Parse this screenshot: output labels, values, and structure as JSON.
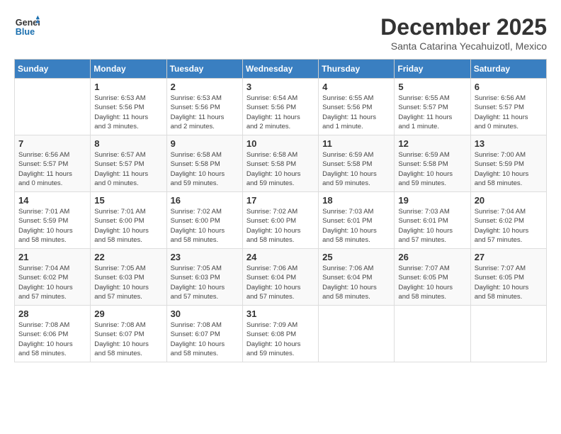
{
  "logo": {
    "line1": "General",
    "line2": "Blue"
  },
  "title": "December 2025",
  "subtitle": "Santa Catarina Yecahuizotl, Mexico",
  "weekdays": [
    "Sunday",
    "Monday",
    "Tuesday",
    "Wednesday",
    "Thursday",
    "Friday",
    "Saturday"
  ],
  "weeks": [
    [
      {
        "day": "",
        "info": ""
      },
      {
        "day": "1",
        "info": "Sunrise: 6:53 AM\nSunset: 5:56 PM\nDaylight: 11 hours\nand 3 minutes."
      },
      {
        "day": "2",
        "info": "Sunrise: 6:53 AM\nSunset: 5:56 PM\nDaylight: 11 hours\nand 2 minutes."
      },
      {
        "day": "3",
        "info": "Sunrise: 6:54 AM\nSunset: 5:56 PM\nDaylight: 11 hours\nand 2 minutes."
      },
      {
        "day": "4",
        "info": "Sunrise: 6:55 AM\nSunset: 5:56 PM\nDaylight: 11 hours\nand 1 minute."
      },
      {
        "day": "5",
        "info": "Sunrise: 6:55 AM\nSunset: 5:57 PM\nDaylight: 11 hours\nand 1 minute."
      },
      {
        "day": "6",
        "info": "Sunrise: 6:56 AM\nSunset: 5:57 PM\nDaylight: 11 hours\nand 0 minutes."
      }
    ],
    [
      {
        "day": "7",
        "info": "Sunrise: 6:56 AM\nSunset: 5:57 PM\nDaylight: 11 hours\nand 0 minutes."
      },
      {
        "day": "8",
        "info": "Sunrise: 6:57 AM\nSunset: 5:57 PM\nDaylight: 11 hours\nand 0 minutes."
      },
      {
        "day": "9",
        "info": "Sunrise: 6:58 AM\nSunset: 5:58 PM\nDaylight: 10 hours\nand 59 minutes."
      },
      {
        "day": "10",
        "info": "Sunrise: 6:58 AM\nSunset: 5:58 PM\nDaylight: 10 hours\nand 59 minutes."
      },
      {
        "day": "11",
        "info": "Sunrise: 6:59 AM\nSunset: 5:58 PM\nDaylight: 10 hours\nand 59 minutes."
      },
      {
        "day": "12",
        "info": "Sunrise: 6:59 AM\nSunset: 5:58 PM\nDaylight: 10 hours\nand 59 minutes."
      },
      {
        "day": "13",
        "info": "Sunrise: 7:00 AM\nSunset: 5:59 PM\nDaylight: 10 hours\nand 58 minutes."
      }
    ],
    [
      {
        "day": "14",
        "info": "Sunrise: 7:01 AM\nSunset: 5:59 PM\nDaylight: 10 hours\nand 58 minutes."
      },
      {
        "day": "15",
        "info": "Sunrise: 7:01 AM\nSunset: 6:00 PM\nDaylight: 10 hours\nand 58 minutes."
      },
      {
        "day": "16",
        "info": "Sunrise: 7:02 AM\nSunset: 6:00 PM\nDaylight: 10 hours\nand 58 minutes."
      },
      {
        "day": "17",
        "info": "Sunrise: 7:02 AM\nSunset: 6:00 PM\nDaylight: 10 hours\nand 58 minutes."
      },
      {
        "day": "18",
        "info": "Sunrise: 7:03 AM\nSunset: 6:01 PM\nDaylight: 10 hours\nand 58 minutes."
      },
      {
        "day": "19",
        "info": "Sunrise: 7:03 AM\nSunset: 6:01 PM\nDaylight: 10 hours\nand 57 minutes."
      },
      {
        "day": "20",
        "info": "Sunrise: 7:04 AM\nSunset: 6:02 PM\nDaylight: 10 hours\nand 57 minutes."
      }
    ],
    [
      {
        "day": "21",
        "info": "Sunrise: 7:04 AM\nSunset: 6:02 PM\nDaylight: 10 hours\nand 57 minutes."
      },
      {
        "day": "22",
        "info": "Sunrise: 7:05 AM\nSunset: 6:03 PM\nDaylight: 10 hours\nand 57 minutes."
      },
      {
        "day": "23",
        "info": "Sunrise: 7:05 AM\nSunset: 6:03 PM\nDaylight: 10 hours\nand 57 minutes."
      },
      {
        "day": "24",
        "info": "Sunrise: 7:06 AM\nSunset: 6:04 PM\nDaylight: 10 hours\nand 57 minutes."
      },
      {
        "day": "25",
        "info": "Sunrise: 7:06 AM\nSunset: 6:04 PM\nDaylight: 10 hours\nand 58 minutes."
      },
      {
        "day": "26",
        "info": "Sunrise: 7:07 AM\nSunset: 6:05 PM\nDaylight: 10 hours\nand 58 minutes."
      },
      {
        "day": "27",
        "info": "Sunrise: 7:07 AM\nSunset: 6:05 PM\nDaylight: 10 hours\nand 58 minutes."
      }
    ],
    [
      {
        "day": "28",
        "info": "Sunrise: 7:08 AM\nSunset: 6:06 PM\nDaylight: 10 hours\nand 58 minutes."
      },
      {
        "day": "29",
        "info": "Sunrise: 7:08 AM\nSunset: 6:07 PM\nDaylight: 10 hours\nand 58 minutes."
      },
      {
        "day": "30",
        "info": "Sunrise: 7:08 AM\nSunset: 6:07 PM\nDaylight: 10 hours\nand 58 minutes."
      },
      {
        "day": "31",
        "info": "Sunrise: 7:09 AM\nSunset: 6:08 PM\nDaylight: 10 hours\nand 59 minutes."
      },
      {
        "day": "",
        "info": ""
      },
      {
        "day": "",
        "info": ""
      },
      {
        "day": "",
        "info": ""
      }
    ]
  ]
}
